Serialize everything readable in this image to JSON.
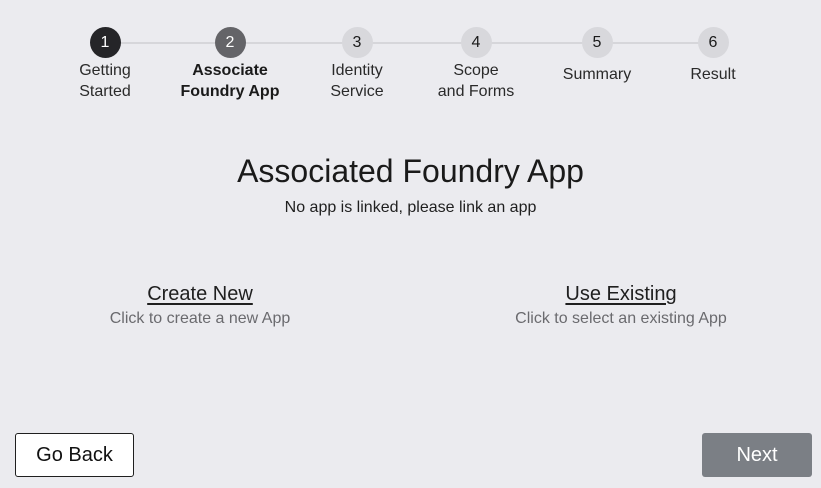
{
  "stepper": {
    "steps": [
      {
        "number": "1",
        "label": "Getting\nStarted",
        "state": "done"
      },
      {
        "number": "2",
        "label": "Associate\nFoundry App",
        "state": "current"
      },
      {
        "number": "3",
        "label": "Identity\nService",
        "state": "todo"
      },
      {
        "number": "4",
        "label": "Scope\nand Forms",
        "state": "todo"
      },
      {
        "number": "5",
        "label": "Summary",
        "state": "todo"
      },
      {
        "number": "6",
        "label": "Result",
        "state": "todo"
      }
    ]
  },
  "main": {
    "title": "Associated Foundry App",
    "subtitle": "No app is linked, please link an app",
    "options": [
      {
        "title": "Create New",
        "description": "Click to create a new App"
      },
      {
        "title": "Use Existing",
        "description": "Click to select an existing App"
      }
    ]
  },
  "footer": {
    "back_label": "Go Back",
    "next_label": "Next"
  },
  "colors": {
    "background": "#ebebef",
    "step_done": "#252528",
    "step_current": "#646468",
    "step_todo": "#d8d8dc",
    "next_button": "#7b7f85"
  }
}
